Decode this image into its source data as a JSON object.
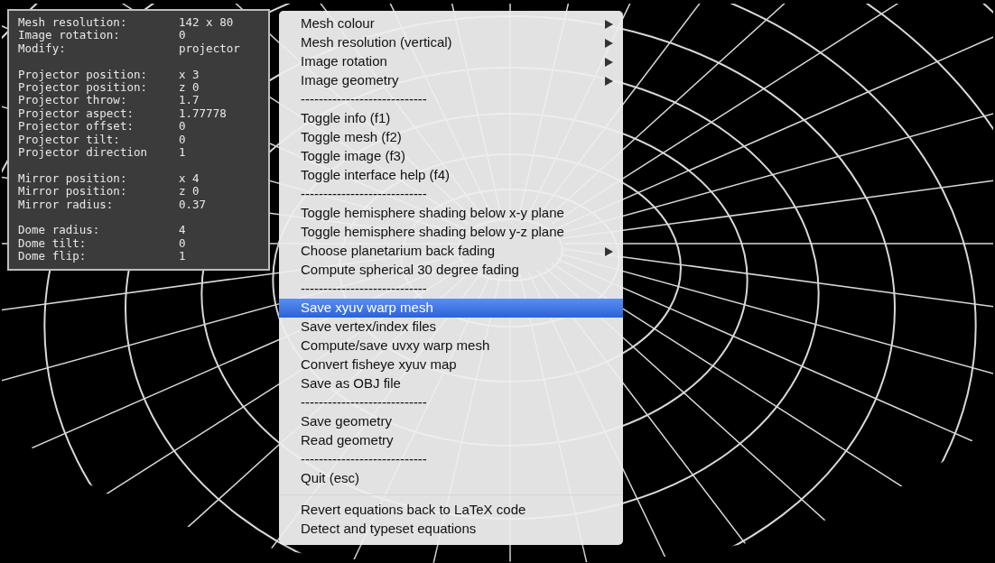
{
  "info_panel": {
    "groups": [
      [
        {
          "label": "Mesh resolution:",
          "value": "142 x 80"
        },
        {
          "label": "Image rotation:",
          "value": "0"
        },
        {
          "label": "Modify:",
          "value": "projector"
        }
      ],
      [
        {
          "label": "Projector position:",
          "value": "x 3"
        },
        {
          "label": "Projector position:",
          "value": "z 0"
        },
        {
          "label": "Projector throw:",
          "value": "1.7"
        },
        {
          "label": "Projector aspect:",
          "value": "1.77778"
        },
        {
          "label": "Projector offset:",
          "value": "0"
        },
        {
          "label": "Projector tilt:",
          "value": "0"
        },
        {
          "label": "Projector direction",
          "value": "1"
        }
      ],
      [
        {
          "label": "Mirror position:",
          "value": "x 4"
        },
        {
          "label": "Mirror position:",
          "value": "z 0"
        },
        {
          "label": "Mirror radius:",
          "value": "0.37"
        }
      ],
      [
        {
          "label": "Dome radius:",
          "value": "4"
        },
        {
          "label": "Dome tilt:",
          "value": "0"
        },
        {
          "label": "Dome flip:",
          "value": "1"
        }
      ]
    ]
  },
  "context_menu": {
    "items": [
      {
        "kind": "item",
        "label": "Mesh colour",
        "submenu": true,
        "selected": false
      },
      {
        "kind": "item",
        "label": "Mesh resolution (vertical)",
        "submenu": true,
        "selected": false
      },
      {
        "kind": "item",
        "label": "Image rotation",
        "submenu": true,
        "selected": false
      },
      {
        "kind": "item",
        "label": "Image geometry",
        "submenu": true,
        "selected": false
      },
      {
        "kind": "dashes",
        "label": "----------------------------"
      },
      {
        "kind": "item",
        "label": "Toggle info (f1)",
        "submenu": false,
        "selected": false
      },
      {
        "kind": "item",
        "label": "Toggle mesh (f2)",
        "submenu": false,
        "selected": false
      },
      {
        "kind": "item",
        "label": "Toggle image (f3)",
        "submenu": false,
        "selected": false
      },
      {
        "kind": "item",
        "label": "Toggle interface help (f4)",
        "submenu": false,
        "selected": false
      },
      {
        "kind": "dashes",
        "label": "----------------------------"
      },
      {
        "kind": "item",
        "label": "Toggle hemisphere shading below x-y plane",
        "submenu": false,
        "selected": false
      },
      {
        "kind": "item",
        "label": "Toggle hemisphere shading below y-z plane",
        "submenu": false,
        "selected": false
      },
      {
        "kind": "item",
        "label": "Choose planetarium back fading",
        "submenu": true,
        "selected": false
      },
      {
        "kind": "item",
        "label": "Compute spherical 30 degree fading",
        "submenu": false,
        "selected": false
      },
      {
        "kind": "dashes",
        "label": "----------------------------"
      },
      {
        "kind": "item",
        "label": "Save xyuv warp mesh",
        "submenu": false,
        "selected": true
      },
      {
        "kind": "item",
        "label": "Save vertex/index files",
        "submenu": false,
        "selected": false
      },
      {
        "kind": "item",
        "label": "Compute/save uvxy warp mesh",
        "submenu": false,
        "selected": false
      },
      {
        "kind": "item",
        "label": "Convert fisheye xyuv map",
        "submenu": false,
        "selected": false
      },
      {
        "kind": "item",
        "label": "Save as OBJ file",
        "submenu": false,
        "selected": false
      },
      {
        "kind": "dashes",
        "label": "----------------------------"
      },
      {
        "kind": "item",
        "label": "Save geometry",
        "submenu": false,
        "selected": false
      },
      {
        "kind": "item",
        "label": "Read geometry",
        "submenu": false,
        "selected": false
      },
      {
        "kind": "dashes",
        "label": "----------------------------"
      },
      {
        "kind": "item",
        "label": "Quit (esc)",
        "submenu": false,
        "selected": false
      },
      {
        "kind": "separator"
      },
      {
        "kind": "item",
        "label": "Revert equations back to LaTeX code",
        "submenu": false,
        "selected": false
      },
      {
        "kind": "item",
        "label": "Detect and typeset equations",
        "submenu": false,
        "selected": false
      }
    ]
  }
}
